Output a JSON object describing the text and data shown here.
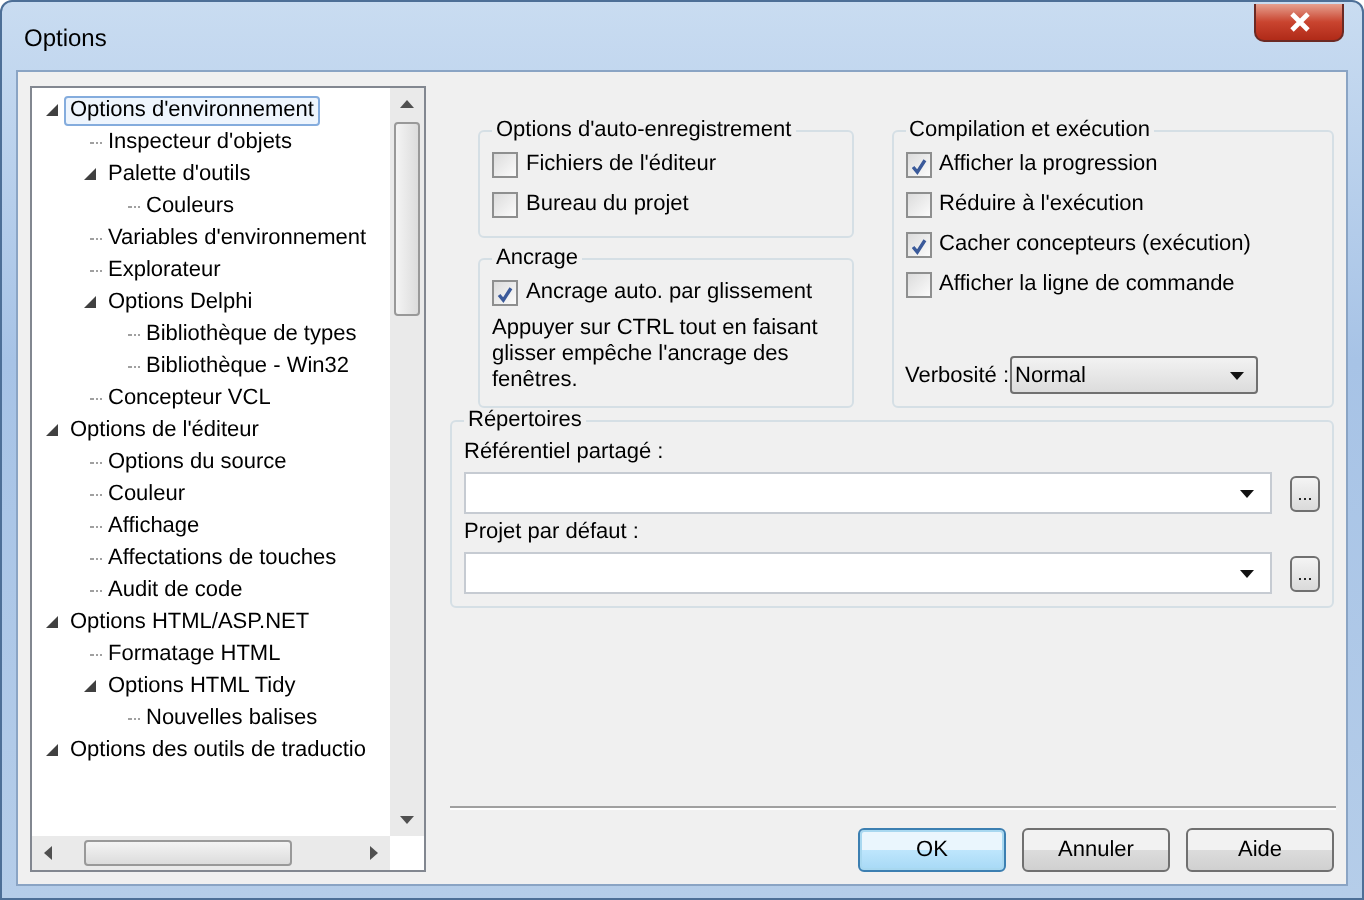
{
  "window": {
    "title": "Options"
  },
  "tree": [
    {
      "label": "Options d'environnement",
      "selected": true,
      "expanded": true,
      "children": [
        {
          "label": "Inspecteur d'objets",
          "selected": false
        },
        {
          "label": "Palette d'outils",
          "selected": false,
          "expanded": true,
          "children": [
            {
              "label": "Couleurs",
              "selected": false
            }
          ]
        },
        {
          "label": "Variables d'environnement",
          "selected": false
        },
        {
          "label": "Explorateur",
          "selected": false
        },
        {
          "label": "Options Delphi",
          "selected": false,
          "expanded": true,
          "children": [
            {
              "label": "Bibliothèque de types",
              "selected": false
            },
            {
              "label": "Bibliothèque - Win32",
              "selected": false
            }
          ]
        },
        {
          "label": "Concepteur VCL",
          "selected": false
        }
      ]
    },
    {
      "label": "Options de l'éditeur",
      "selected": false,
      "expanded": true,
      "children": [
        {
          "label": "Options du source",
          "selected": false
        },
        {
          "label": "Couleur",
          "selected": false
        },
        {
          "label": "Affichage",
          "selected": false
        },
        {
          "label": "Affectations de touches",
          "selected": false
        },
        {
          "label": "Audit de code",
          "selected": false
        }
      ]
    },
    {
      "label": "Options HTML/ASP.NET",
      "selected": false,
      "expanded": true,
      "children": [
        {
          "label": "Formatage HTML",
          "selected": false
        },
        {
          "label": "Options HTML Tidy",
          "selected": false,
          "expanded": true,
          "children": [
            {
              "label": "Nouvelles balises",
              "selected": false
            }
          ]
        }
      ]
    },
    {
      "label": "Options des outils de traductio",
      "selected": false,
      "expanded": true
    }
  ],
  "autosave": {
    "title": "Options d'auto-enregistrement",
    "checkboxes": [
      {
        "label": "Fichiers de l'éditeur",
        "checked": false
      },
      {
        "label": "Bureau du projet",
        "checked": false
      }
    ]
  },
  "docking": {
    "title": "Ancrage",
    "checkboxes": [
      {
        "label": "Ancrage auto. par glissement",
        "checked": true
      }
    ],
    "note": "Appuyer sur CTRL tout en faisant glisser empêche l'ancrage des fenêtres."
  },
  "compile": {
    "title": "Compilation et exécution",
    "checkboxes": [
      {
        "label": "Afficher la progression",
        "checked": true
      },
      {
        "label": "Réduire à l'exécution",
        "checked": false
      },
      {
        "label": "Cacher concepteurs (exécution)",
        "checked": true
      },
      {
        "label": "Afficher la ligne de commande",
        "checked": false
      }
    ],
    "verbosity": {
      "label": "Verbosité :",
      "value": "Normal"
    }
  },
  "directories": {
    "title": "Répertoires",
    "fields": [
      {
        "label": "Référentiel partagé :",
        "browse": "..."
      },
      {
        "label": "Projet par défaut :",
        "browse": "..."
      }
    ]
  },
  "buttons": [
    {
      "label": "OK",
      "default": true
    },
    {
      "label": "Annuler",
      "default": false
    },
    {
      "label": "Aide",
      "default": false
    }
  ]
}
